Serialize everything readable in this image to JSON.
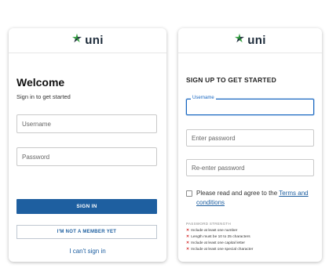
{
  "brand": {
    "name": "uni"
  },
  "signin": {
    "title": "Welcome",
    "subtitle": "Sign in to get started",
    "username_placeholder": "Username",
    "password_placeholder": "Password",
    "signin_button": "SIGN IN",
    "not_member_button": "I'M NOT A MEMBER YET",
    "cant_signin_link": "I can't sign in"
  },
  "signup": {
    "title": "SIGN UP TO GET STARTED",
    "username_label": "Username",
    "password_placeholder": "Enter password",
    "reenter_placeholder": "Re-enter password",
    "agree_text": "Please read and agree to the",
    "terms_link": "Terms and conditions",
    "strength_title": "PASSWORD STRENGTH",
    "rules": [
      "Include at least one number",
      "Length must be 10 to 25 characters",
      "Include at least one capital letter",
      "Include at least one special character"
    ]
  },
  "colors": {
    "primary": "#1e5fa0",
    "error": "#d32f2f",
    "logo_green": "#2e9c3b",
    "logo_navy": "#1d2b3a"
  }
}
